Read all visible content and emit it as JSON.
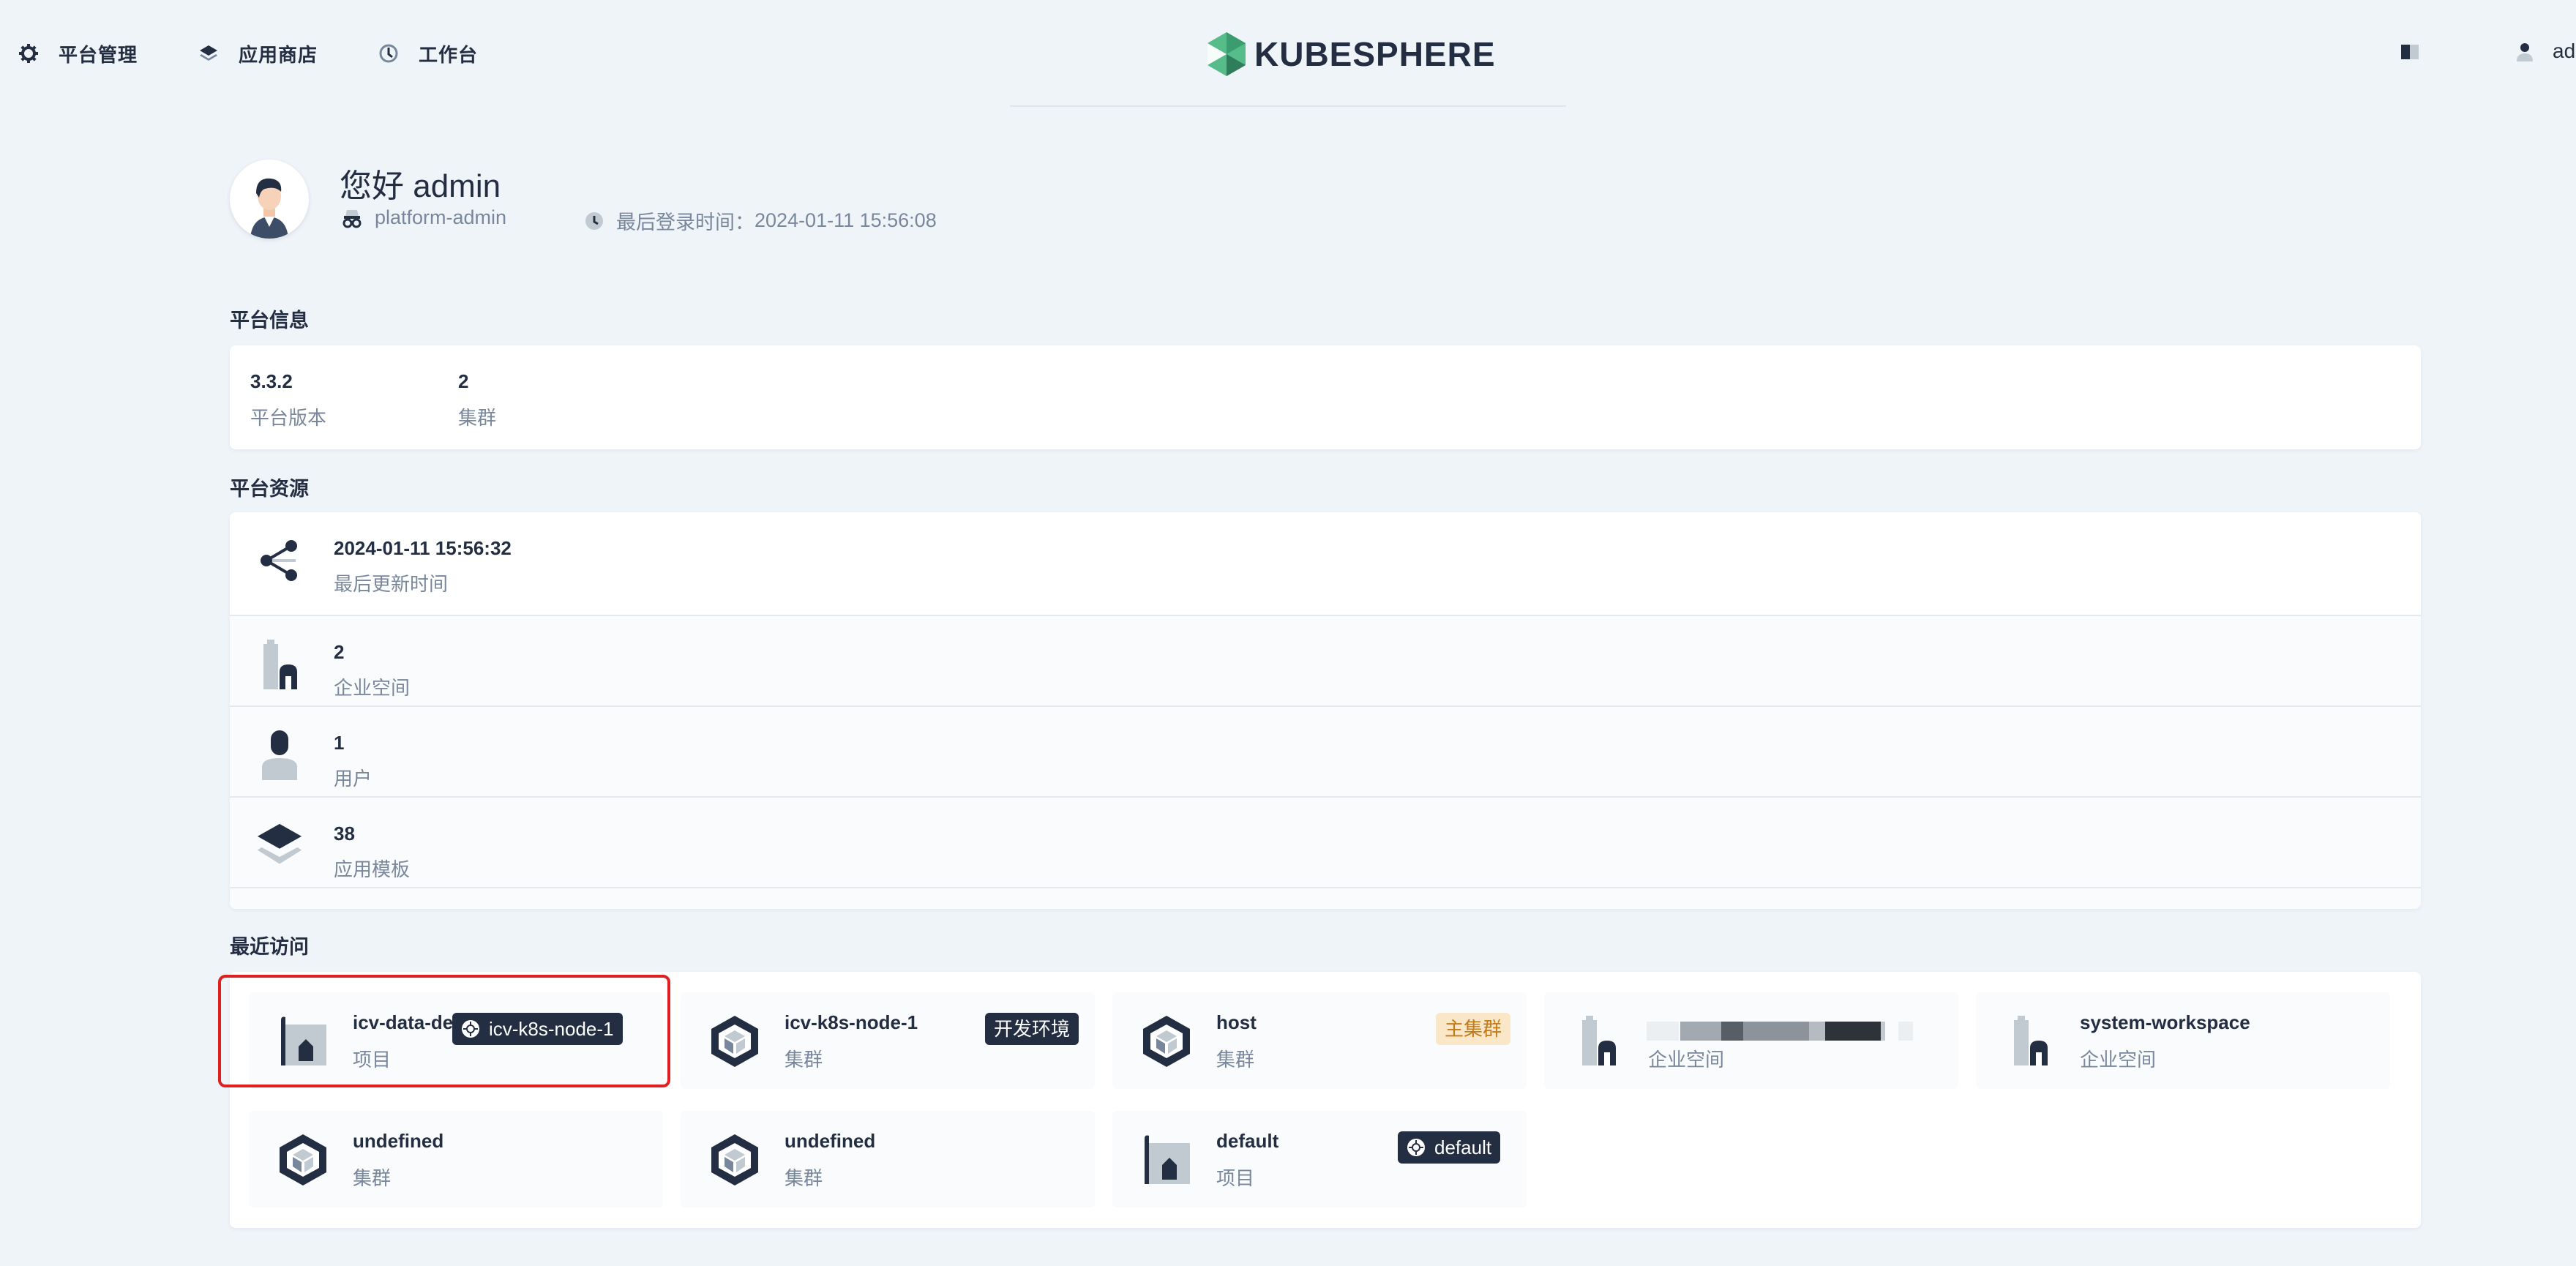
{
  "header": {
    "nav": [
      {
        "label": "平台管理",
        "icon": "gear-icon"
      },
      {
        "label": "应用商店",
        "icon": "layers-icon"
      },
      {
        "label": "工作台",
        "icon": "dashboard-icon"
      }
    ],
    "logo_text": "KUBESPHERE",
    "user": "ad"
  },
  "welcome": {
    "greeting": "您好 admin",
    "role": "platform-admin",
    "last_login_label": "最后登录时间：",
    "last_login_time": "2024-01-11 15:56:08"
  },
  "platform_info": {
    "title": "平台信息",
    "items": [
      {
        "value": "3.3.2",
        "label": "平台版本"
      },
      {
        "value": "2",
        "label": "集群"
      }
    ]
  },
  "platform_resources": {
    "title": "平台资源",
    "items": [
      {
        "value": "2024-01-11 15:56:32",
        "label": "最后更新时间",
        "icon": "share-icon"
      },
      {
        "value": "2",
        "label": "企业空间",
        "icon": "workspace-icon"
      },
      {
        "value": "1",
        "label": "用户",
        "icon": "user-icon"
      },
      {
        "value": "38",
        "label": "应用模板",
        "icon": "app-template-icon"
      }
    ]
  },
  "recent": {
    "title": "最近访问",
    "tiles": [
      {
        "name": "icv-data-de",
        "type": "项目",
        "badge": "icv-k8s-node-1",
        "icon": "project-icon"
      },
      {
        "name": "icv-k8s-node-1",
        "type": "集群",
        "badge": "开发环境",
        "icon": "cluster-icon"
      },
      {
        "name": "host",
        "type": "集群",
        "badge": "主集群",
        "icon": "cluster-icon"
      },
      {
        "name": "",
        "type": "企业空间",
        "icon": "workspace-icon"
      },
      {
        "name": "system-workspace",
        "type": "企业空间",
        "icon": "workspace-icon"
      },
      {
        "name": "undefined",
        "type": "集群",
        "icon": "cluster-icon"
      },
      {
        "name": "undefined",
        "type": "集群",
        "icon": "cluster-icon"
      },
      {
        "name": "default",
        "type": "项目",
        "badge": "default",
        "icon": "project-icon"
      }
    ]
  },
  "colors": {
    "background": "#eff4f9",
    "text_primary": "#242e42",
    "text_secondary": "#79879c",
    "brand_green": "#55bc8a",
    "highlight_red": "#e02020",
    "warn_badge_bg": "#fae7c8"
  }
}
